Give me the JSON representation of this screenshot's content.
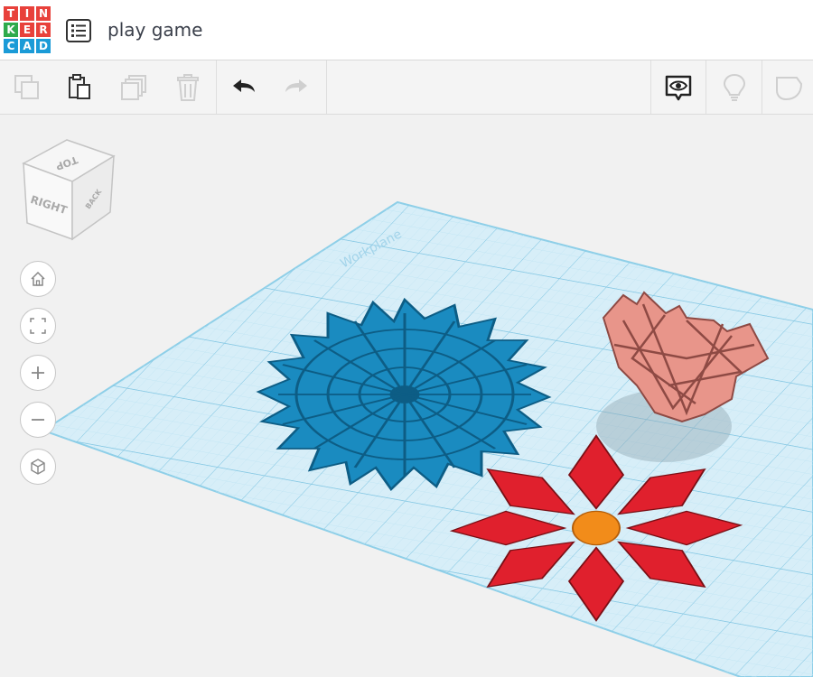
{
  "logo": {
    "letters": [
      "T",
      "I",
      "N",
      "K",
      "E",
      "R",
      "C",
      "A",
      "D"
    ],
    "colors": [
      "#e8413b",
      "#e8413b",
      "#e8413b",
      "#2eaa4b",
      "#e8413b",
      "#e8413b",
      "#1b9bd7",
      "#1b9bd7",
      "#1b9bd7"
    ]
  },
  "header": {
    "title": "play game"
  },
  "viewcube": {
    "top_label": "TOP",
    "right_label": "RIGHT",
    "back_label": "BACK"
  },
  "workplane": {
    "label": "Workplane"
  },
  "colors": {
    "grid": "#8ecfe8",
    "blue_shape": "#1a8bc0",
    "red_shape": "#e0202d",
    "orange_center": "#f28c1a",
    "pink_shape": "#e8958a"
  }
}
